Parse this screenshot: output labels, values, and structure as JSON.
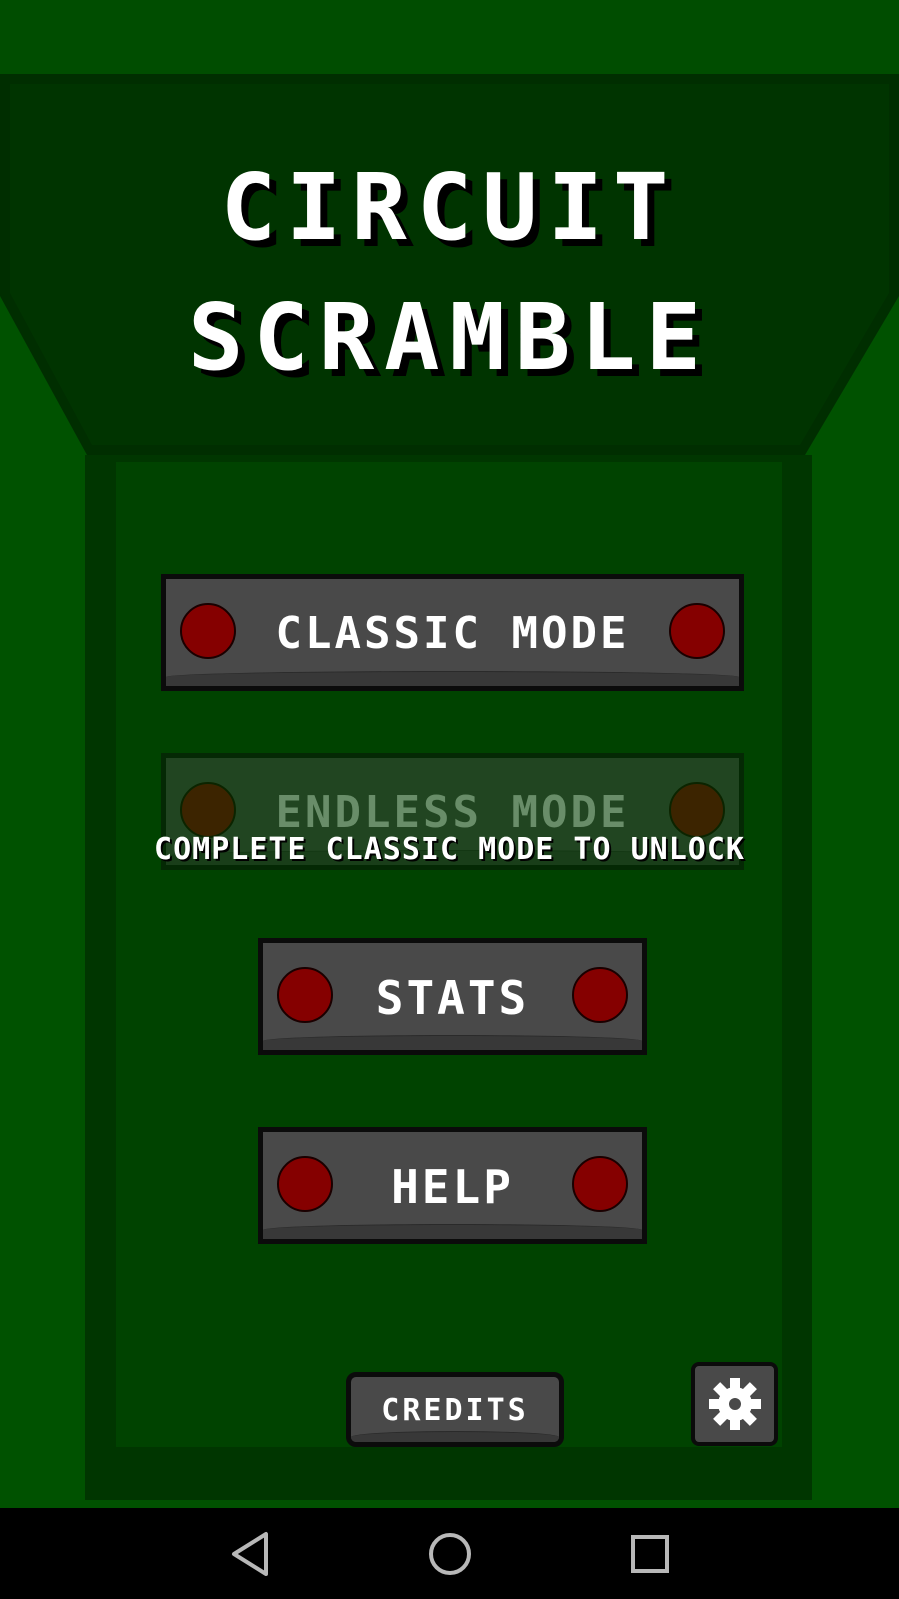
{
  "title": {
    "line1": "CIRCUIT",
    "line2": "SCRAMBLE"
  },
  "menu": {
    "classic_label": "CLASSIC MODE",
    "endless_label": "ENDLESS MODE",
    "endless_lock_note": "COMPLETE CLASSIC MODE TO UNLOCK",
    "stats_label": "STATS",
    "help_label": "HELP",
    "credits_label": "CREDITS"
  },
  "icons": {
    "settings": "gear-icon",
    "nav_back": "back-triangle-icon",
    "nav_home": "home-circle-icon",
    "nav_recents": "recents-square-icon"
  },
  "colors": {
    "background": "#004d00",
    "button": "#494949",
    "led": "#850000"
  }
}
